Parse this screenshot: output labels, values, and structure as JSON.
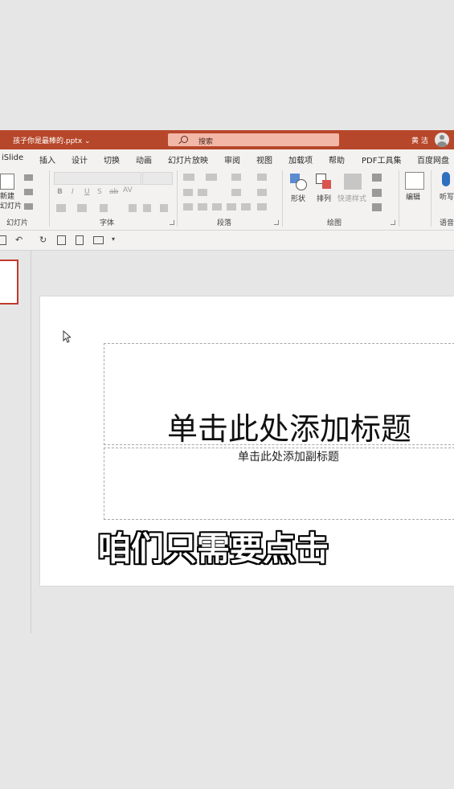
{
  "window": {
    "doc_title": "孩子你是最棒的.pptx ⌄",
    "search_placeholder": "搜索",
    "user_name": "黄 洁"
  },
  "tabs": [
    "iSlide",
    "插入",
    "设计",
    "切换",
    "动画",
    "幻灯片放映",
    "审阅",
    "视图",
    "加载项",
    "帮助",
    "PDF工具集",
    "百度网盘"
  ],
  "ribbon": {
    "new_slide_label": "新建\n幻灯片",
    "groups": {
      "slides": "幻灯片",
      "font": "字体",
      "paragraph": "段落",
      "drawing": "绘图",
      "voice": "语音"
    },
    "font_buttons": [
      "B",
      "I",
      "U",
      "S",
      "ab",
      "AV"
    ],
    "shape_label": "形状",
    "arrange_label": "排列",
    "quick_styles_label": "快速样式",
    "edit_label": "编辑",
    "dictate_label": "听写"
  },
  "slide": {
    "title_placeholder": "单击此处添加标题",
    "subtitle_placeholder": "单击此处添加副标题"
  },
  "caption": "咱们只需要点击",
  "colors": {
    "accent": "#b7472a",
    "search_bg": "#f3b7a8",
    "ribbon_bg": "#f3f2f1",
    "work_bg": "#e6e6e6"
  }
}
